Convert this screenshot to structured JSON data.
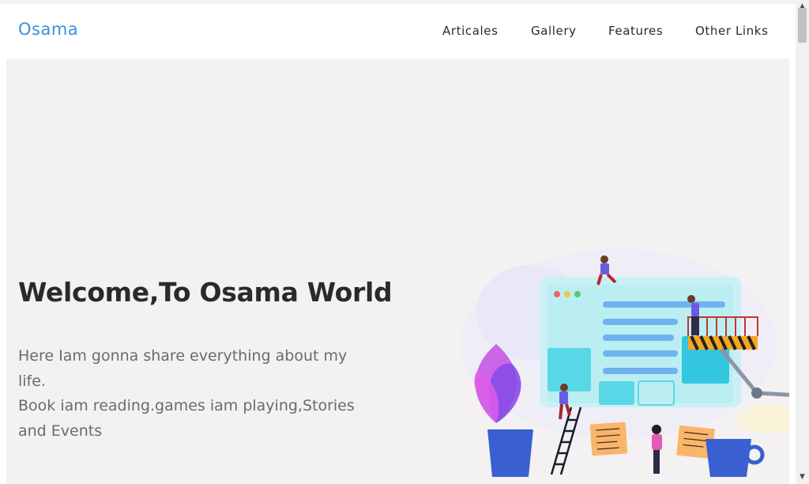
{
  "header": {
    "logo": "Osama",
    "nav": [
      {
        "label": "Articales"
      },
      {
        "label": "Gallery"
      },
      {
        "label": "Features"
      },
      {
        "label": "Other Links"
      }
    ]
  },
  "hero": {
    "title": "Welcome,To Osama World",
    "line1": "Here Iam gonna share everything about my life.",
    "line2": "Book iam reading.games iam playing,Stories and Events"
  },
  "illustration": {
    "icon": "team-building-website-illustration"
  },
  "colors": {
    "accent": "#3b8fe0",
    "page_background": "#f3f1f2",
    "header_background": "#ffffff",
    "title": "#2a2a2a",
    "body_text": "#6b6b6b"
  }
}
